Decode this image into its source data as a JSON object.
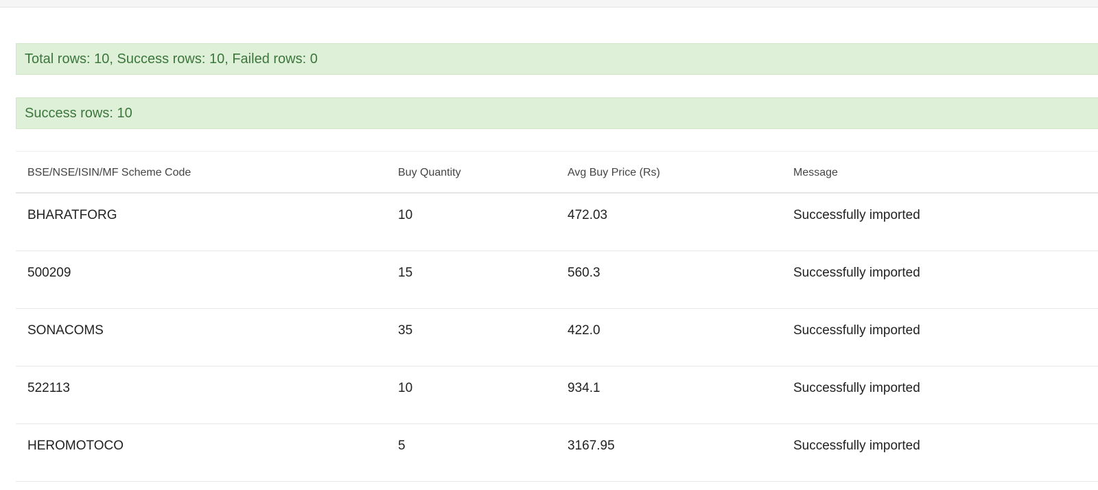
{
  "alerts": {
    "summary": "Total rows: 10, Success rows: 10, Failed rows: 0",
    "success": "Success rows: 10"
  },
  "colors": {
    "alert_background": "#dff0d8",
    "alert_text": "#3c763d"
  },
  "table": {
    "headers": {
      "code": "BSE/NSE/ISIN/MF Scheme Code",
      "quantity": "Buy Quantity",
      "price": "Avg Buy Price (Rs)",
      "message": "Message"
    },
    "rows": [
      {
        "code": "BHARATFORG",
        "quantity": "10",
        "price": "472.03",
        "message": "Successfully imported"
      },
      {
        "code": "500209",
        "quantity": "15",
        "price": "560.3",
        "message": "Successfully imported"
      },
      {
        "code": "SONACOMS",
        "quantity": "35",
        "price": "422.0",
        "message": "Successfully imported"
      },
      {
        "code": "522113",
        "quantity": "10",
        "price": "934.1",
        "message": "Successfully imported"
      },
      {
        "code": "HEROMOTOCO",
        "quantity": "5",
        "price": "3167.95",
        "message": "Successfully imported"
      }
    ]
  }
}
